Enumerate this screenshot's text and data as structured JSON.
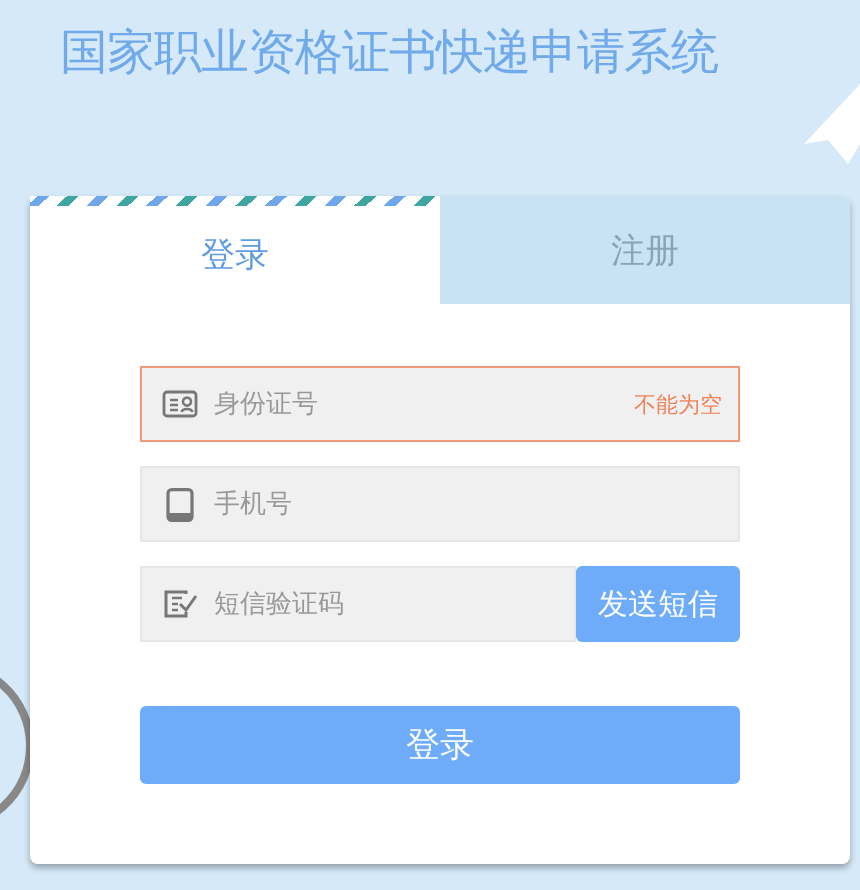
{
  "title": "国家职业资格证书快递申请系统",
  "tabs": [
    {
      "label": "登录",
      "selected": true
    },
    {
      "label": "注册",
      "selected": false
    }
  ],
  "fields": [
    {
      "kind": "id",
      "placeholder": "身份证号",
      "error": "不能为空"
    },
    {
      "kind": "phone",
      "placeholder": "手机号"
    },
    {
      "kind": "code",
      "placeholder": "短信验证码",
      "button": "发送短信"
    }
  ],
  "submit": "登录"
}
